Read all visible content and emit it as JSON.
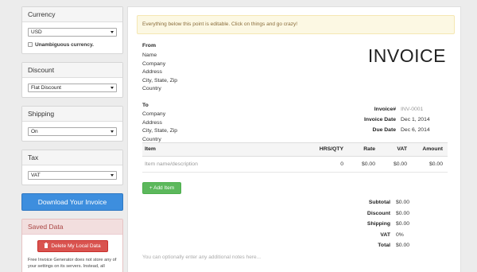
{
  "sidebar": {
    "currency": {
      "heading": "Currency",
      "selected": "USD",
      "checkbox_label": "Unambiguous currency."
    },
    "discount": {
      "heading": "Discount",
      "selected": "Flat Discount"
    },
    "shipping": {
      "heading": "Shipping",
      "selected": "On"
    },
    "tax": {
      "heading": "Tax",
      "selected": "VAT"
    },
    "download_label": "Download Your Invoice",
    "saved": {
      "heading": "Saved Data",
      "delete_label": "Delete My Local Data",
      "note": "Free Invoice Generator does not store any of your settings on its servers. Instead, all"
    }
  },
  "main": {
    "alert": "Everything below this point is editable. Click on things and go crazy!",
    "title": "INVOICE",
    "from": {
      "label": "From",
      "lines": [
        "Name",
        "Company",
        "Address",
        "City, State, Zip",
        "Country"
      ]
    },
    "to": {
      "label": "To",
      "lines": [
        "Company",
        "Address",
        "City, State, Zip",
        "Country"
      ]
    },
    "meta": {
      "number_label": "Invoice#",
      "number_value": "INV-0001",
      "date_label": "Invoice Date",
      "date_value": "Dec 1, 2014",
      "due_label": "Due Date",
      "due_value": "Dec 6, 2014"
    },
    "table": {
      "headers": {
        "item": "Item",
        "hrs": "HRS/QTY",
        "rate": "Rate",
        "vat": "VAT",
        "amount": "Amount"
      },
      "rows": [
        {
          "item": "Item name/description",
          "hrs": "0",
          "rate": "$0.00",
          "vat": "$0.00",
          "amount": "$0.00"
        }
      ]
    },
    "add_item_label": "+ Add Item",
    "totals": [
      {
        "label": "Subtotal",
        "value": "$0.00"
      },
      {
        "label": "Discount",
        "value": "$0.00"
      },
      {
        "label": "Shipping",
        "value": "$0.00"
      },
      {
        "label": "VAT",
        "value": "0%"
      },
      {
        "label": "Total",
        "value": "$0.00"
      }
    ],
    "notes_placeholder": "You can optionally enter any additional notes here..."
  },
  "icons": {
    "trash": "trash-icon",
    "caret": "caret-down-icon"
  },
  "colors": {
    "primary": "#3d8ede",
    "danger": "#d9534f",
    "success": "#5cb85c",
    "alert_bg": "#fcf8e3"
  }
}
